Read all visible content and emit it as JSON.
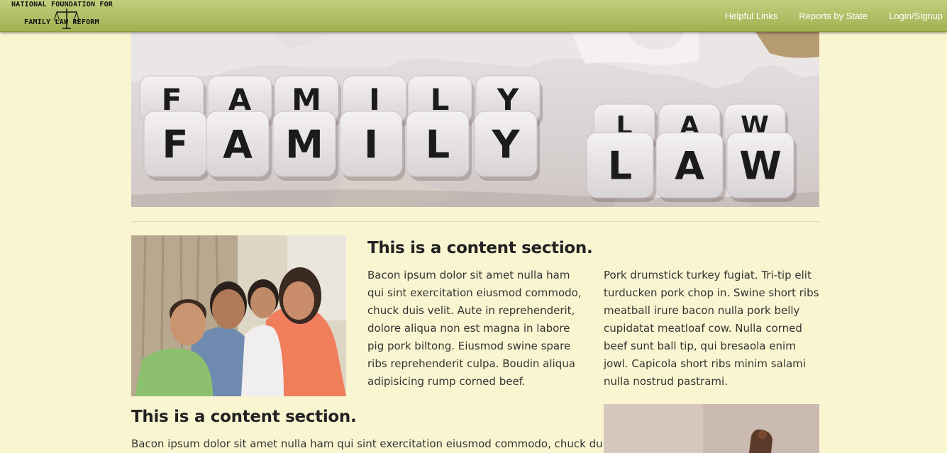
{
  "logo": {
    "line1": "NATIONAL FOUNDATION FOR",
    "line2": "FAMILY LAW REFORM"
  },
  "nav": {
    "items": [
      "Helpful Links",
      "Reports by State",
      "Login/Signup"
    ]
  },
  "hero": {
    "top_word": [
      "F",
      "A",
      "M",
      "I",
      "L",
      "Y"
    ],
    "bottom_word": [
      "F",
      "A",
      "M",
      "I",
      "L",
      "Y"
    ],
    "law_top": [
      "L",
      "A",
      "W"
    ],
    "law_bottom": [
      "L",
      "A",
      "W"
    ]
  },
  "section1": {
    "heading": "This is a content section.",
    "col1": "Bacon ipsum dolor sit amet nulla ham qui sint exercitation eiusmod commodo, chuck duis velit. Aute in reprehenderit, dolore aliqua non est magna in labore pig pork biltong. Eiusmod swine spare ribs reprehenderit culpa. Boudin aliqua adipisicing rump corned beef.",
    "col2": "Pork drumstick turkey fugiat. Tri-tip elit turducken pork chop in. Swine short ribs meatball irure bacon nulla pork belly cupidatat meatloaf cow. Nulla corned beef sunt ball tip, qui bresaola enim jowl. Capicola short ribs minim salami nulla nostrud pastrami."
  },
  "section2": {
    "heading": "This is a content section.",
    "text": "Bacon ipsum dolor sit amet nulla ham qui sint exercitation eiusmod commodo, chuck duis"
  },
  "colors": {
    "page_bg": "#faf5d1",
    "nav_top": "#c2cf7f",
    "nav_bottom": "#a1b150",
    "nav_text": "#ffffff"
  }
}
